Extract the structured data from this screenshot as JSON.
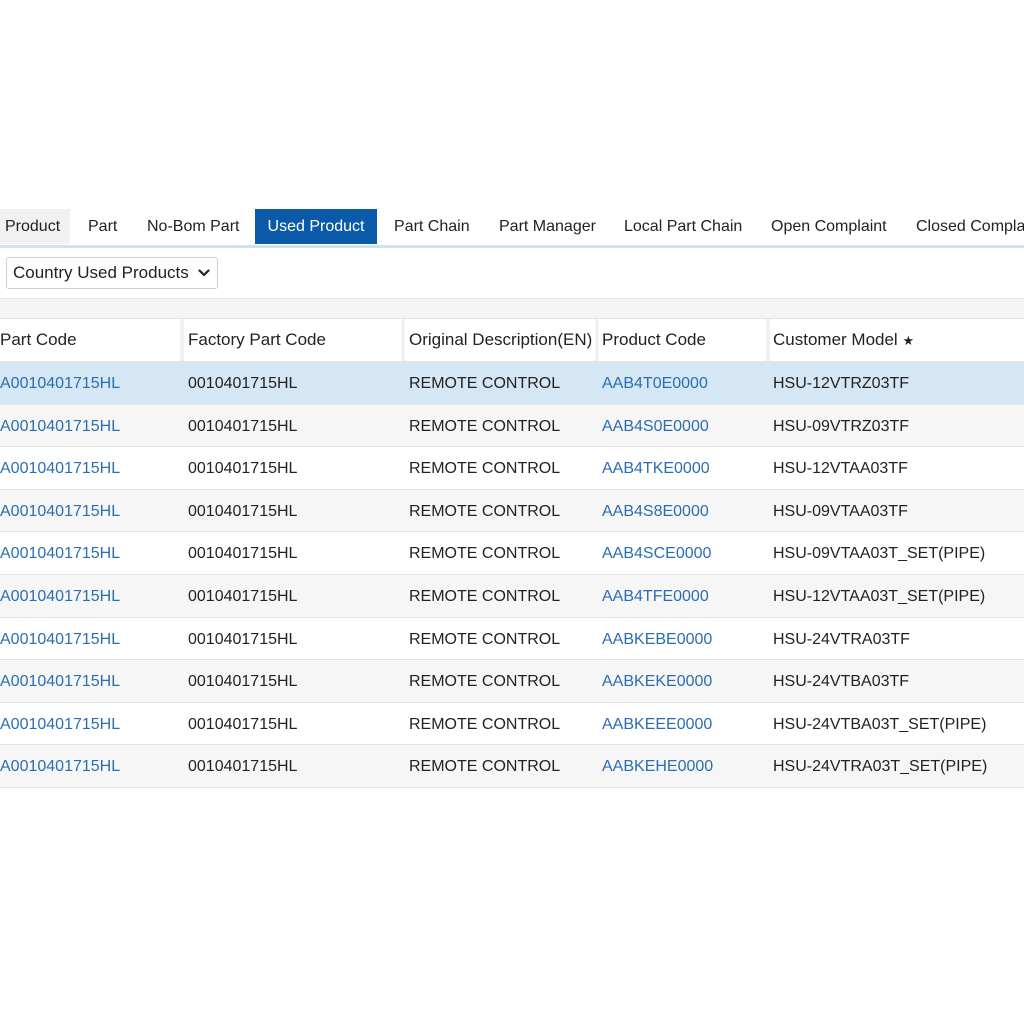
{
  "tabs": [
    {
      "label": "Product",
      "active": false
    },
    {
      "label": "Part",
      "active": false
    },
    {
      "label": "No-Bom Part",
      "active": false
    },
    {
      "label": "Used Product",
      "active": true
    },
    {
      "label": "Part Chain",
      "active": false
    },
    {
      "label": "Part Manager",
      "active": false
    },
    {
      "label": "Local Part Chain",
      "active": false
    },
    {
      "label": "Open Complaint",
      "active": false
    },
    {
      "label": "Closed Complaint",
      "active": false
    }
  ],
  "filter": {
    "selected": "Country Used Products"
  },
  "table": {
    "columns": [
      "Part Code",
      "Factory Part Code",
      "Original Description(EN)",
      "Product Code",
      "Customer Model"
    ],
    "star_glyph": "★",
    "rows": [
      {
        "part_code": "A0010401715HL",
        "factory_part_code": "0010401715HL",
        "description": "REMOTE CONTROL",
        "product_code": "AAB4T0E0000",
        "customer_model": "HSU-12VTRZ03TF"
      },
      {
        "part_code": "A0010401715HL",
        "factory_part_code": "0010401715HL",
        "description": "REMOTE CONTROL",
        "product_code": "AAB4S0E0000",
        "customer_model": "HSU-09VTRZ03TF"
      },
      {
        "part_code": "A0010401715HL",
        "factory_part_code": "0010401715HL",
        "description": "REMOTE CONTROL",
        "product_code": "AAB4TKE0000",
        "customer_model": "HSU-12VTAA03TF"
      },
      {
        "part_code": "A0010401715HL",
        "factory_part_code": "0010401715HL",
        "description": "REMOTE CONTROL",
        "product_code": "AAB4S8E0000",
        "customer_model": "HSU-09VTAA03TF"
      },
      {
        "part_code": "A0010401715HL",
        "factory_part_code": "0010401715HL",
        "description": "REMOTE CONTROL",
        "product_code": "AAB4SCE0000",
        "customer_model": "HSU-09VTAA03T_SET(PIPE)"
      },
      {
        "part_code": "A0010401715HL",
        "factory_part_code": "0010401715HL",
        "description": "REMOTE CONTROL",
        "product_code": "AAB4TFE0000",
        "customer_model": "HSU-12VTAA03T_SET(PIPE)"
      },
      {
        "part_code": "A0010401715HL",
        "factory_part_code": "0010401715HL",
        "description": "REMOTE CONTROL",
        "product_code": "AABKEBE0000",
        "customer_model": "HSU-24VTRA03TF"
      },
      {
        "part_code": "A0010401715HL",
        "factory_part_code": "0010401715HL",
        "description": "REMOTE CONTROL",
        "product_code": "AABKEKE0000",
        "customer_model": "HSU-24VTBA03TF"
      },
      {
        "part_code": "A0010401715HL",
        "factory_part_code": "0010401715HL",
        "description": "REMOTE CONTROL",
        "product_code": "AABKEEE0000",
        "customer_model": "HSU-24VTBA03T_SET(PIPE)"
      },
      {
        "part_code": "A0010401715HL",
        "factory_part_code": "0010401715HL",
        "description": "REMOTE CONTROL",
        "product_code": "AABKEHE0000",
        "customer_model": "HSU-24VTRA03T_SET(PIPE)"
      }
    ]
  },
  "colors": {
    "active_tab": "#0a5aa8",
    "link": "#2a6eb0",
    "selected_row": "#d5e6f5"
  }
}
